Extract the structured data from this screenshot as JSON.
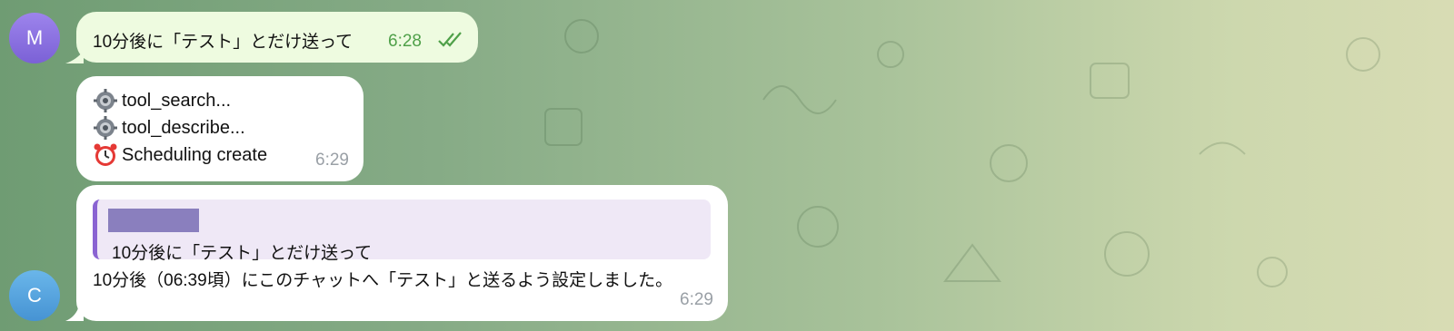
{
  "messages": {
    "outgoing": {
      "text": "10分後に「テスト」とだけ送って",
      "time": "6:28",
      "status": "double-check-icon"
    },
    "tool_status": {
      "lines": [
        {
          "icon": "gear-icon",
          "text": "tool_search..."
        },
        {
          "icon": "gear-icon",
          "text": "tool_describe..."
        },
        {
          "icon": "alarm-clock-icon",
          "text": "Scheduling create"
        }
      ],
      "time": "6:29"
    },
    "reply": {
      "quoted_text": "10分後に「テスト」とだけ送って",
      "text": "10分後（06:39頃）にこのチャットへ「テスト」と送るよう設定しました。",
      "time": "6:29"
    }
  },
  "avatars": {
    "user": "M",
    "bot": "C"
  },
  "colors": {
    "outgoing_bubble": "#eefbe0",
    "incoming_bubble": "#ffffff",
    "check": "#4fa049",
    "quote_bar": "#8a63d2"
  }
}
